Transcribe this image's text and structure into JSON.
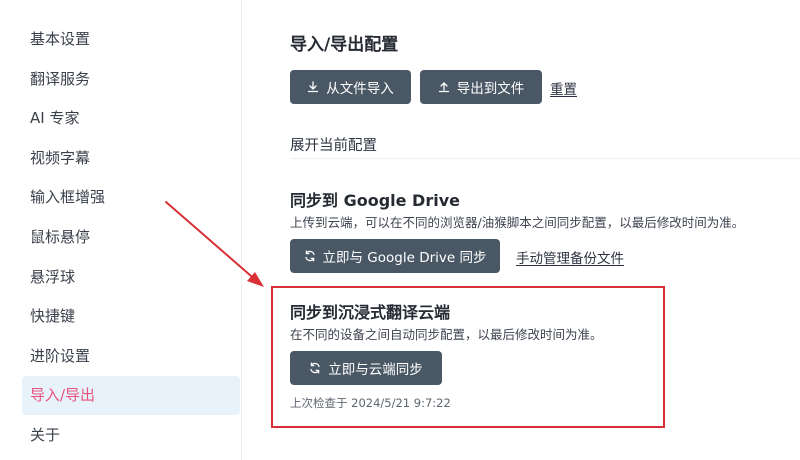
{
  "sidebar": {
    "items": [
      {
        "label": "基本设置"
      },
      {
        "label": "翻译服务"
      },
      {
        "label": "AI 专家"
      },
      {
        "label": "视频字幕"
      },
      {
        "label": "输入框增强"
      },
      {
        "label": "鼠标悬停"
      },
      {
        "label": "悬浮球"
      },
      {
        "label": "快捷键"
      },
      {
        "label": "进阶设置"
      },
      {
        "label": "导入/导出"
      },
      {
        "label": "关于"
      }
    ],
    "active_index": 9
  },
  "main": {
    "title": "导入/导出配置",
    "import_button": "从文件导入",
    "export_button": "导出到文件",
    "reset_link": "重置",
    "expand_label": "展开当前配置",
    "google": {
      "title": "同步到 Google Drive",
      "desc": "上传到云端，可以在不同的浏览器/油猴脚本之间同步配置，以最后修改时间为准。",
      "sync_button": "立即与 Google Drive 同步",
      "manage_link": "手动管理备份文件"
    },
    "cloud": {
      "title": "同步到沉浸式翻译云端",
      "desc": "在不同的设备之间自动同步配置，以最后修改时间为准。",
      "sync_button": "立即与云端同步",
      "last_check": "上次检查于 2024/5/21 9:7:22"
    }
  },
  "icons": {
    "import": "download-icon",
    "export": "upload-icon",
    "sync": "sync-icon"
  },
  "colors": {
    "button_bg": "#4a5866",
    "active_bg": "#e7f2fb",
    "active_text": "#e8527c",
    "annotation": "#d93036"
  }
}
